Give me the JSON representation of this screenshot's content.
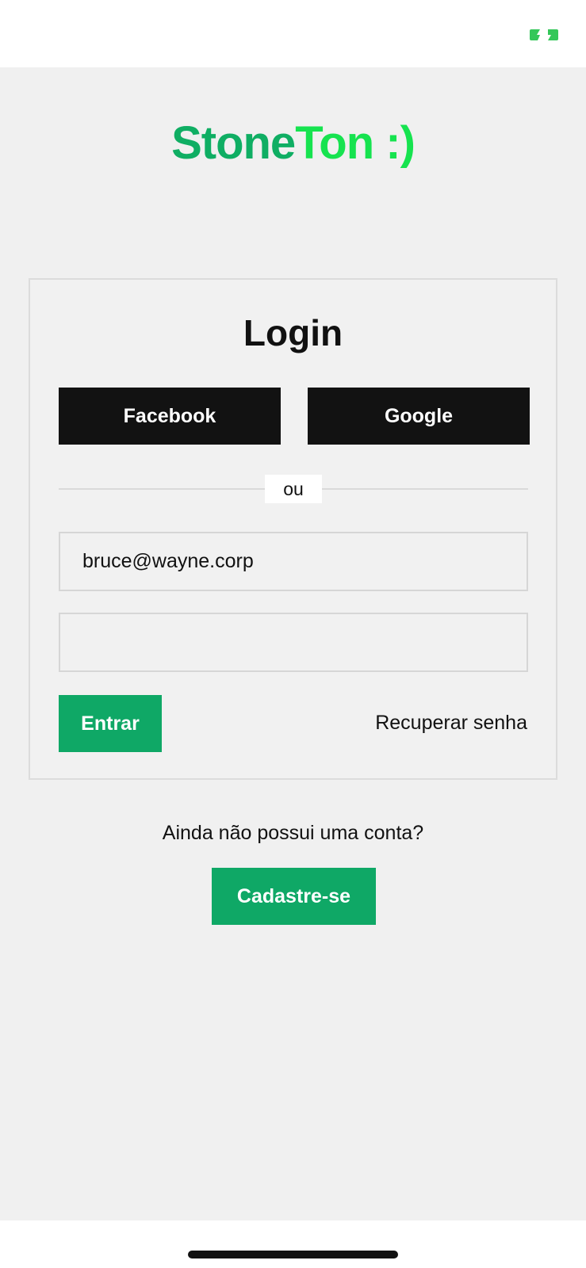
{
  "status_bar": {
    "icon": "battery-charging-icon",
    "accent": "#34c759"
  },
  "logo": {
    "part1": "Stone",
    "part2": "Ton :)",
    "color1": "#0fae63",
    "color2": "#16e34f"
  },
  "login": {
    "title": "Login",
    "facebook_label": "Facebook",
    "google_label": "Google",
    "divider_label": "ou",
    "email_value": "bruce@wayne.corp",
    "password_value": "",
    "enter_label": "Entrar",
    "recover_label": "Recuperar senha"
  },
  "signup": {
    "prompt": "Ainda não possui uma conta?",
    "button_label": "Cadastre-se"
  },
  "colors": {
    "primary": "#0fa866",
    "dark_button": "#121212",
    "background": "#f0f0f0"
  }
}
